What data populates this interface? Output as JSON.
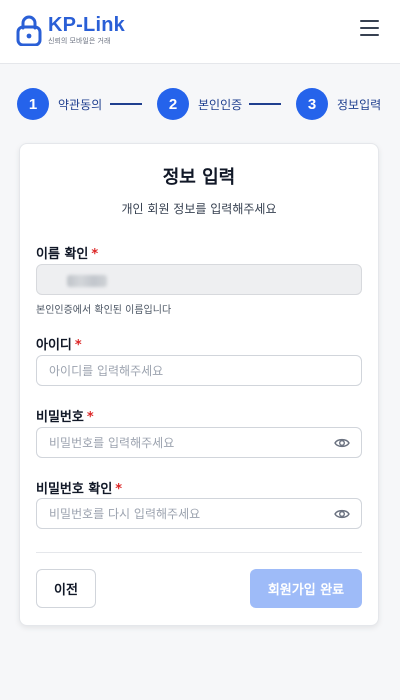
{
  "header": {
    "brand": "KP-Link",
    "tagline": "신뢰의 모바일은 거래",
    "logo_icon": "lock-icon",
    "menu_icon": "hamburger-menu-icon"
  },
  "steps": [
    {
      "number": "1",
      "label": "약관동의"
    },
    {
      "number": "2",
      "label": "본인인증"
    },
    {
      "number": "3",
      "label": "정보입력"
    }
  ],
  "form": {
    "title": "정보 입력",
    "subtitle": "개인 회원 정보를 입력해주세요",
    "required_mark": "*",
    "name": {
      "label": "이름 확인",
      "value": "",
      "help": "본인인증에서 확인된 이름입니다"
    },
    "user_id": {
      "label": "아이디",
      "value": "",
      "placeholder": "아이디를 입력해주세요"
    },
    "password": {
      "label": "비밀번호",
      "value": "",
      "placeholder": "비밀번호를 입력해주세요",
      "icon": "eye-icon"
    },
    "password_confirm": {
      "label": "비밀번호 확인",
      "value": "",
      "placeholder": "비밀번호를 다시 입력해주세요",
      "icon": "eye-icon"
    }
  },
  "actions": {
    "prev_label": "이전",
    "submit_label": "회원가입 완료"
  },
  "colors": {
    "accent": "#2563eb",
    "brand": "#2a5fd6",
    "required": "#dc2626",
    "submit_disabled": "#9ebbf8"
  }
}
